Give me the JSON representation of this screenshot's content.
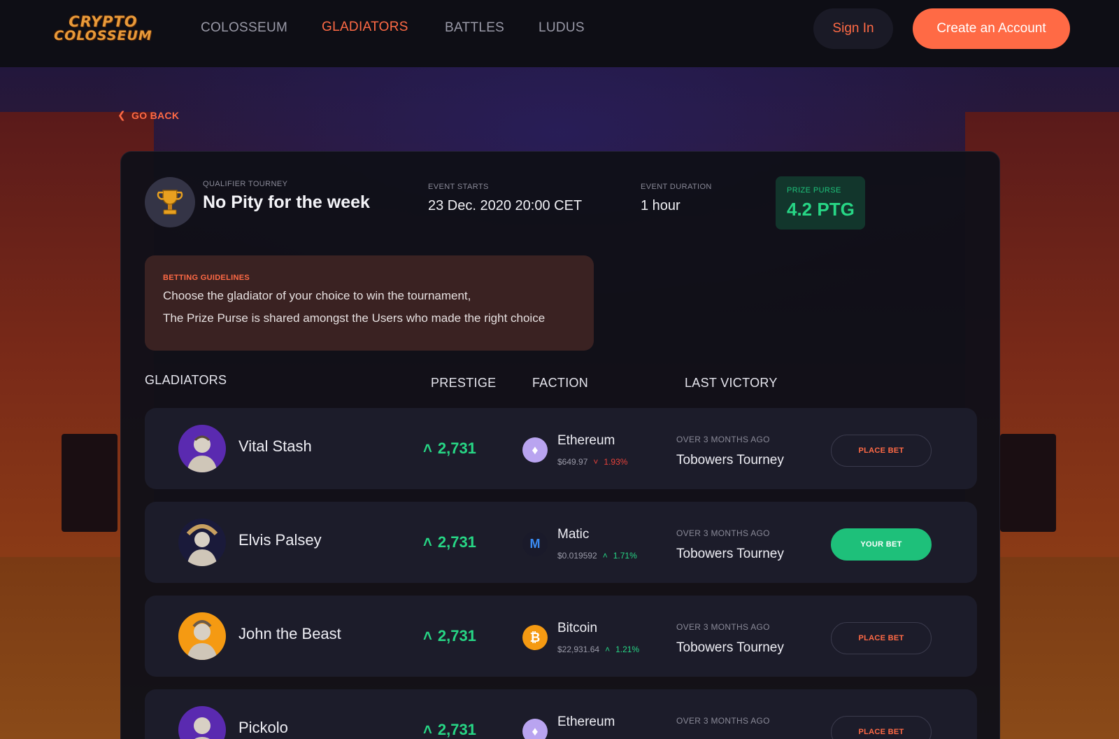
{
  "brand": {
    "line1": "CRYPTO",
    "line2": "COLOSSEUM"
  },
  "nav": {
    "links": [
      {
        "label": "COLOSSEUM"
      },
      {
        "label": "GLADIATORS"
      },
      {
        "label": "BATTLES"
      },
      {
        "label": "LUDUS"
      }
    ],
    "active": "GLADIATORS",
    "sign_in": "Sign In",
    "create_account": "Create an Account"
  },
  "go_back": "GO BACK",
  "event": {
    "type_label": "QUALIFIER TOURNEY",
    "title": "No Pity for the week",
    "starts_label": "EVENT STARTS",
    "starts_value": "23 Dec. 2020 20:00 CET",
    "duration_label": "EVENT DURATION",
    "duration_value": "1 hour",
    "prize_label": "PRIZE PURSE",
    "prize_value": "4.2 PTG"
  },
  "guidelines": {
    "label": "BETTING GUIDELINES",
    "line1": "Choose the gladiator of your choice to win the tournament,",
    "line2": "The Prize Purse is shared amongst the Users who made the right choice"
  },
  "columns": {
    "gladiators": "GLADIATORS",
    "prestige": "PRESTIGE",
    "faction": "FACTION",
    "last_victory": "LAST VICTORY"
  },
  "rows": [
    {
      "name": "Vital Stash",
      "prestige": "2,731",
      "faction": "Ethereum",
      "price": "$649.97",
      "change": "1.93%",
      "trend": "down",
      "last_label": "OVER 3 MONTHS AGO",
      "last_value": "Tobowers Tourney",
      "action": "PLACE BET"
    },
    {
      "name": "Elvis Palsey",
      "prestige": "2,731",
      "faction": "Matic",
      "price": "$0.019592",
      "change": "1.71%",
      "trend": "up",
      "last_label": "OVER 3 MONTHS AGO",
      "last_value": "Tobowers Tourney",
      "action": "YOUR BET"
    },
    {
      "name": "John the Beast",
      "prestige": "2,731",
      "faction": "Bitcoin",
      "price": "$22,931.64",
      "change": "1.21%",
      "trend": "up",
      "last_label": "OVER 3 MONTHS AGO",
      "last_value": "Tobowers Tourney",
      "action": "PLACE BET"
    },
    {
      "name": "Pickolo",
      "prestige": "2,731",
      "faction": "Ethereum",
      "price": "",
      "change": "",
      "trend": "",
      "last_label": "OVER 3 MONTHS AGO",
      "last_value": "",
      "action": "PLACE BET"
    }
  ],
  "colors": {
    "accent": "#ff6a45",
    "positive": "#27d685",
    "negative": "#e8423a",
    "your_bet": "#1ec07a"
  }
}
